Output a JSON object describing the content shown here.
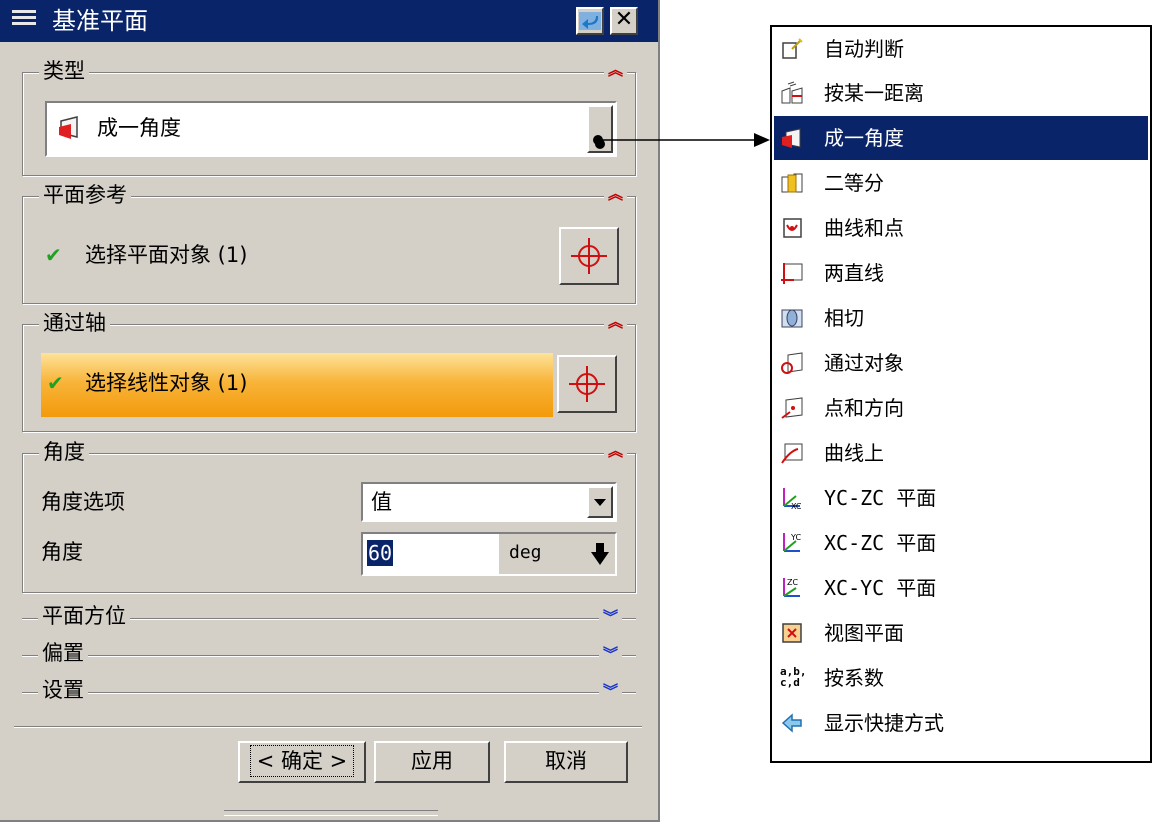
{
  "dialog": {
    "title": "基准平面",
    "type_group": {
      "title": "类型",
      "selected": "成一角度"
    },
    "plane_ref_group": {
      "title": "平面参考",
      "selection_text": "选择平面对象 (1)"
    },
    "axis_group": {
      "title": "通过轴",
      "selection_text": "选择线性对象 (1)"
    },
    "angle_group": {
      "title": "角度",
      "option_label": "角度选项",
      "option_value": "值",
      "angle_label": "角度",
      "angle_value": "60",
      "angle_unit": "deg"
    },
    "collapsed_groups": [
      "平面方位",
      "偏置",
      "设置"
    ],
    "buttons": {
      "ok": "< 确定 >",
      "apply": "应用",
      "cancel": "取消"
    }
  },
  "menu": {
    "items": [
      {
        "label": "自动判断",
        "icon": "auto-infer-icon"
      },
      {
        "label": "按某一距离",
        "icon": "distance-icon"
      },
      {
        "label": "成一角度",
        "icon": "angle-icon",
        "selected": true
      },
      {
        "label": "二等分",
        "icon": "bisector-icon"
      },
      {
        "label": "曲线和点",
        "icon": "curve-point-icon"
      },
      {
        "label": "两直线",
        "icon": "two-lines-icon"
      },
      {
        "label": "相切",
        "icon": "tangent-icon"
      },
      {
        "label": "通过对象",
        "icon": "through-object-icon"
      },
      {
        "label": "点和方向",
        "icon": "point-direction-icon"
      },
      {
        "label": "曲线上",
        "icon": "on-curve-icon"
      },
      {
        "label": "YC-ZC 平面",
        "icon": "yc-zc-plane-icon"
      },
      {
        "label": "XC-ZC 平面",
        "icon": "xc-zc-plane-icon"
      },
      {
        "label": "XC-YC 平面",
        "icon": "xc-yc-plane-icon"
      },
      {
        "label": "视图平面",
        "icon": "view-plane-icon"
      },
      {
        "label": "按系数",
        "icon": "coefficients-icon",
        "icon_text": "a,b,\nc,d"
      },
      {
        "label": "显示快捷方式",
        "icon": "show-shortcuts-icon"
      }
    ]
  },
  "colors": {
    "titlebar": "#0a246a",
    "selection_highlight": "#f5a000",
    "menu_selected": "#0a246a"
  }
}
